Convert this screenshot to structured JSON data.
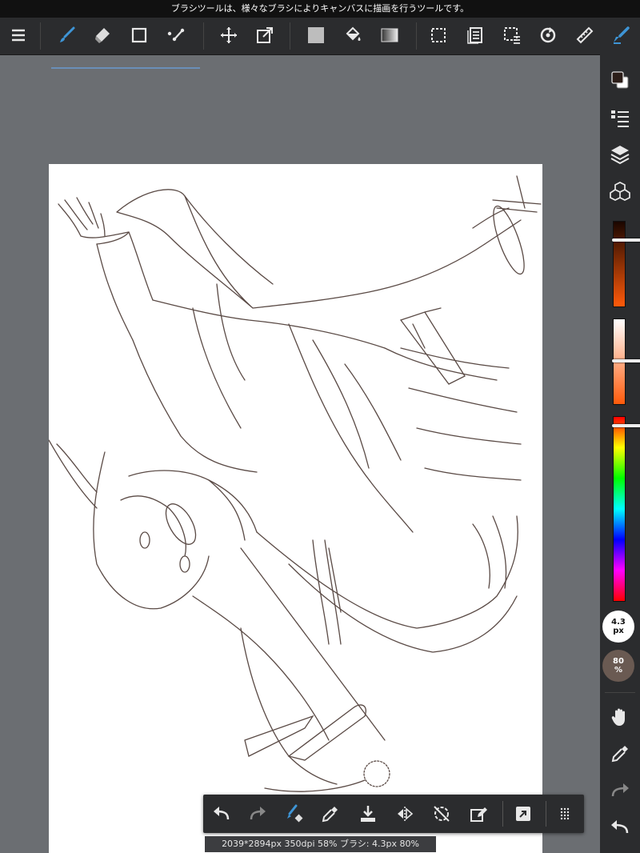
{
  "banner": {
    "text": "ブラシツールは、様々なブラシによりキャンバスに描画を行うツールです。"
  },
  "toolbar": {
    "items": [
      {
        "name": "menu-icon"
      },
      {
        "name": "brush-tool-icon",
        "active": true
      },
      {
        "name": "eraser-tool-icon"
      },
      {
        "name": "shape-tool-icon"
      },
      {
        "name": "dot-line-tool-icon"
      },
      {
        "name": "move-tool-icon"
      },
      {
        "name": "transform-tool-icon"
      },
      {
        "name": "fill-color-icon"
      },
      {
        "name": "bucket-tool-icon"
      },
      {
        "name": "gradient-tool-icon"
      },
      {
        "name": "selection-tool-icon"
      },
      {
        "name": "layer-list-icon"
      },
      {
        "name": "select-options-icon"
      },
      {
        "name": "rotate-icon"
      },
      {
        "name": "ruler-icon"
      },
      {
        "name": "pen-active-icon"
      }
    ],
    "accent": "#3e95d6"
  },
  "sidebar": {
    "colors": {
      "foreground": "#2b1d18",
      "background": "#ffffff"
    },
    "brush_size": {
      "value": "4.3",
      "unit": "px"
    },
    "opacity": {
      "value": "80",
      "unit": "%"
    },
    "slider_hue_gradient": [
      "#ff0000",
      "#ffff00",
      "#00ff00",
      "#00ffff",
      "#0000ff",
      "#ff00ff",
      "#ff0000"
    ]
  },
  "bottom_bar": {
    "items": [
      {
        "name": "undo-icon"
      },
      {
        "name": "redo-icon"
      },
      {
        "name": "brush-eraser-toggle-icon"
      },
      {
        "name": "eyedropper-icon"
      },
      {
        "name": "save-icon"
      },
      {
        "name": "flip-icon"
      },
      {
        "name": "rotate-reset-icon"
      },
      {
        "name": "edit-icon"
      },
      {
        "name": "external-icon"
      },
      {
        "name": "grid-menu-icon"
      }
    ]
  },
  "status": {
    "text": "2039*2894px 350dpi 58% ブラシ: 4.3px 80%"
  }
}
